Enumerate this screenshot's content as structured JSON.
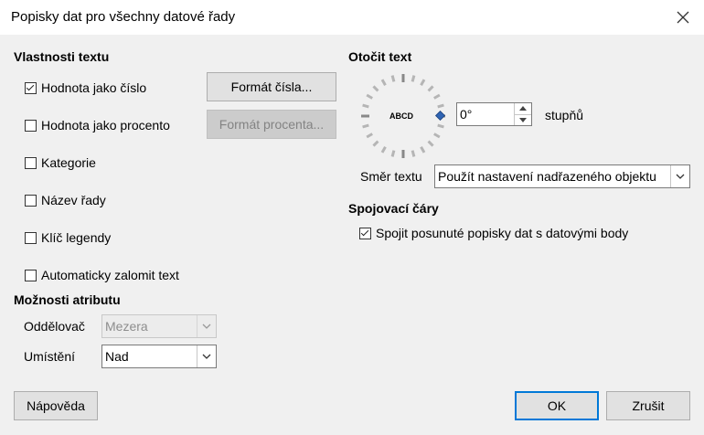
{
  "window": {
    "title": "Popisky dat pro všechny datové řady"
  },
  "text_props": {
    "heading": "Vlastnosti textu",
    "value_as_number": {
      "label": "Hodnota jako číslo",
      "checked": true
    },
    "value_as_percent": {
      "label": "Hodnota jako procento",
      "checked": false
    },
    "category": {
      "label": "Kategorie",
      "checked": false
    },
    "series_name": {
      "label": "Název řady",
      "checked": false
    },
    "legend_key": {
      "label": "Klíč legendy",
      "checked": false
    },
    "auto_wrap": {
      "label": "Automaticky zalomit text",
      "checked": false
    },
    "number_format_button": "Formát čísla...",
    "percent_format_button": "Formát procenta..."
  },
  "attr_options": {
    "heading": "Možnosti atributu",
    "separator_label": "Oddělovač",
    "separator_value": "Mezera",
    "placement_label": "Umístění",
    "placement_value": "Nad"
  },
  "rotate": {
    "heading": "Otočit text",
    "dial_text": "ABCD",
    "degrees_value": "0°",
    "degrees_unit": "stupňů",
    "direction_label": "Směr textu",
    "direction_value": "Použít nastavení nadřazeného objektu"
  },
  "leader_lines": {
    "heading": "Spojovací čáry",
    "connect": {
      "label": "Spojit posunuté popisky dat s datovými body",
      "checked": true
    }
  },
  "footer": {
    "help": "Nápověda",
    "ok": "OK",
    "cancel": "Zrušit"
  }
}
